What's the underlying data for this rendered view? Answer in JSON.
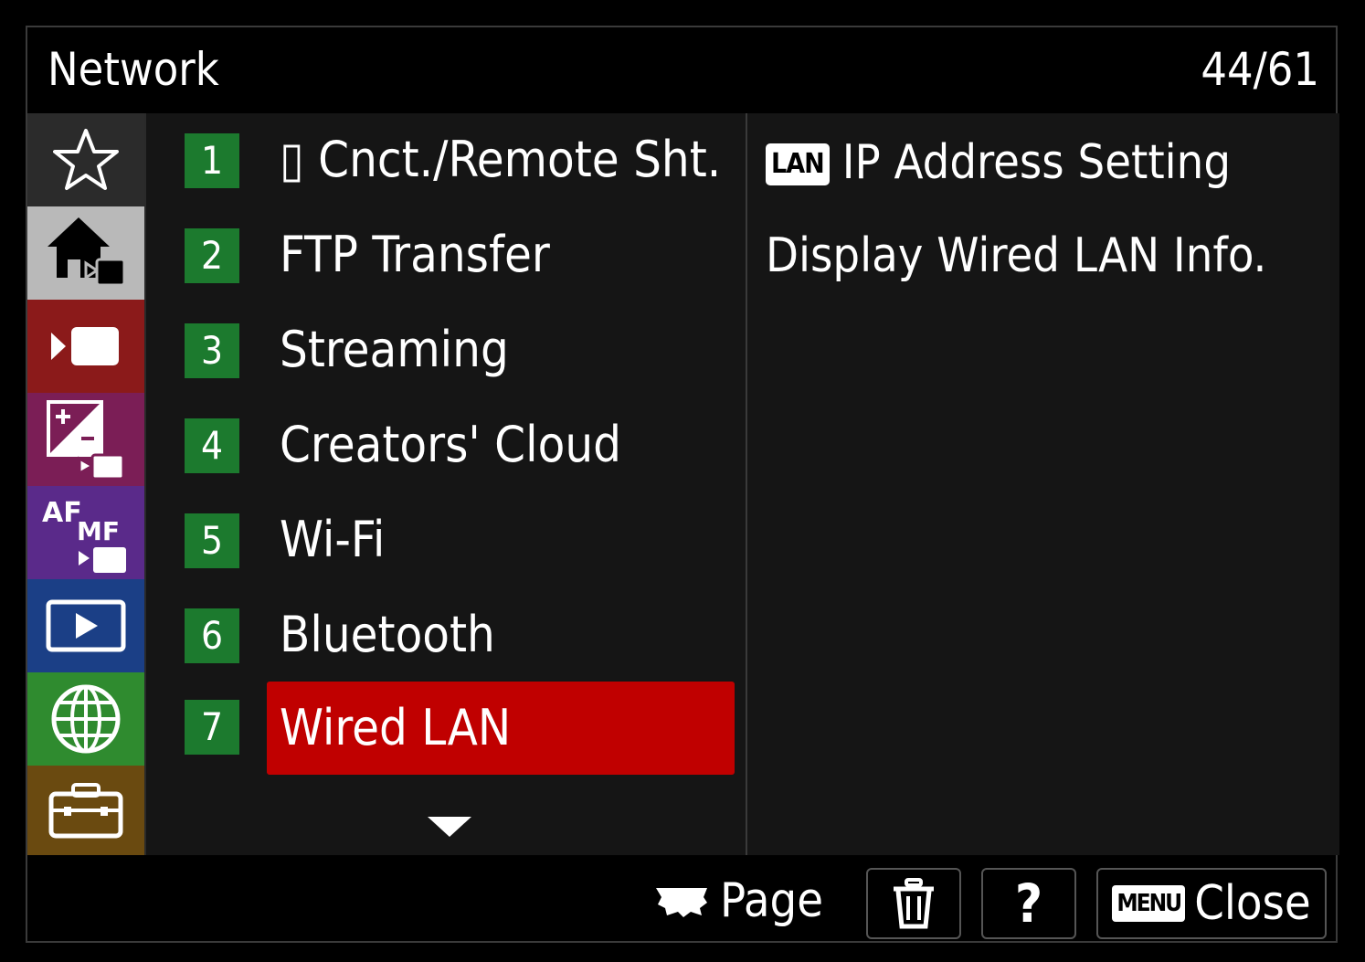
{
  "header": {
    "title": "Network",
    "page_indicator": "44/61"
  },
  "tabs": [
    {
      "name": "my-menu",
      "icon": "star-icon",
      "color": "#2b2b2b"
    },
    {
      "name": "shooting",
      "icon": "home-camera-icon",
      "color": "#b9b9b9"
    },
    {
      "name": "exposure-color",
      "icon": "movie-camera-icon",
      "color": "#8b1a1a"
    },
    {
      "name": "exposure-comp",
      "icon": "exposure-comp-icon",
      "color": "#7b1e56"
    },
    {
      "name": "focus",
      "icon": "af-mf-icon",
      "color": "#5a2a8a",
      "text_af": "AF",
      "text_mf": "MF"
    },
    {
      "name": "playback",
      "icon": "playback-icon",
      "color": "#1b3f86"
    },
    {
      "name": "network",
      "icon": "globe-icon",
      "color": "#2f8b2f"
    },
    {
      "name": "setup",
      "icon": "toolbox-icon",
      "color": "#6a4a10"
    }
  ],
  "list": {
    "items": [
      {
        "num": "1",
        "label": "▯ Cnct./Remote Sht."
      },
      {
        "num": "2",
        "label": "FTP Transfer"
      },
      {
        "num": "3",
        "label": "Streaming"
      },
      {
        "num": "4",
        "label": "Creators' Cloud"
      },
      {
        "num": "5",
        "label": "Wi-Fi"
      },
      {
        "num": "6",
        "label": "Bluetooth"
      },
      {
        "num": "7",
        "label": "Wired LAN",
        "selected": true
      }
    ],
    "more_icon": "chevron-down-icon"
  },
  "detail": {
    "lines": [
      {
        "badge": "LAN",
        "text": "IP Address Setting"
      },
      {
        "badge": "",
        "text": "Display Wired LAN Info."
      }
    ]
  },
  "footer": {
    "page_label": "Page",
    "page_icon": "dial-icon",
    "delete_icon": "trash-icon",
    "help_label": "?",
    "menu_badge": "MENU",
    "close_label": "Close"
  },
  "colors": {
    "accent_selected": "#c00000",
    "number_bg": "#1c7a2e"
  }
}
